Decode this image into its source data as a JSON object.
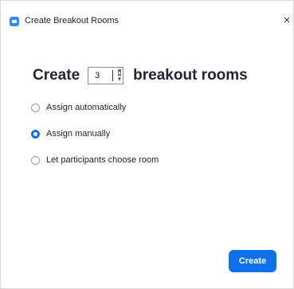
{
  "window": {
    "title": "Create Breakout Rooms",
    "close_glyph": "×",
    "icon": "zoom-app-icon"
  },
  "heading": {
    "prefix": "Create",
    "room_count": "3",
    "suffix": "breakout rooms",
    "spin_up_glyph": "▴",
    "spin_down_glyph": "▾"
  },
  "options": [
    {
      "label": "Assign automatically",
      "selected": false
    },
    {
      "label": "Assign manually",
      "selected": true
    },
    {
      "label": "Let participants choose room",
      "selected": false
    }
  ],
  "footer": {
    "create_label": "Create"
  },
  "colors": {
    "accent": "#0e71eb",
    "text": "#232333"
  }
}
